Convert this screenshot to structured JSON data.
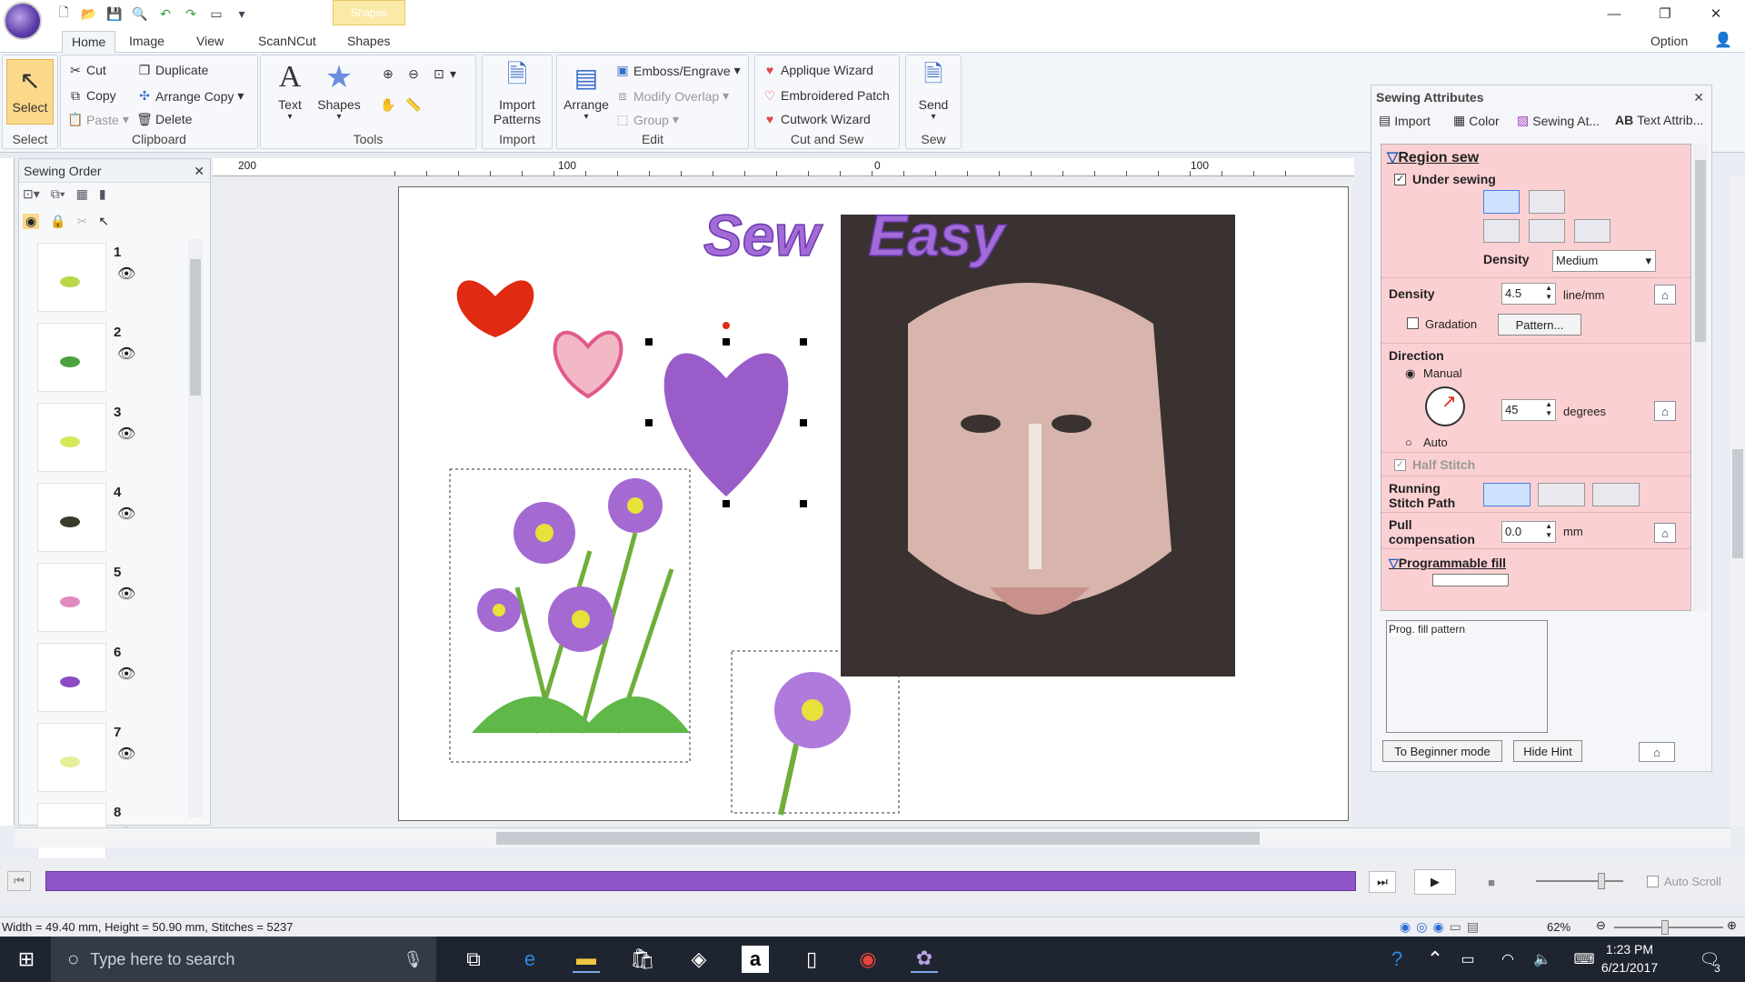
{
  "titlebar": {
    "context_tab": "Shapes",
    "option_label": "Option",
    "minimize": "—",
    "restore": "❐",
    "close": "✕"
  },
  "tabs": [
    "Home",
    "Image",
    "View",
    "ScanNCut",
    "Shapes"
  ],
  "ribbon": {
    "select": {
      "label": "Select",
      "group": "Select"
    },
    "clipboard": {
      "cut": "Cut",
      "copy": "Copy",
      "paste": "Paste",
      "duplicate": "Duplicate",
      "arrange_copy": "Arrange Copy",
      "delete": "Delete",
      "group": "Clipboard"
    },
    "tools": {
      "text": "Text",
      "shapes": "Shapes",
      "group": "Tools"
    },
    "import": {
      "label": "Import Patterns",
      "group": "Import"
    },
    "edit": {
      "arrange": "Arrange",
      "emboss": "Emboss/Engrave",
      "modify_overlap": "Modify Overlap",
      "group_btn": "Group",
      "group": "Edit"
    },
    "cutsew": {
      "applique": "Applique Wizard",
      "patch": "Embroidered Patch",
      "cutwork": "Cutwork Wizard",
      "group": "Cut and Sew"
    },
    "sew": {
      "send": "Send",
      "group": "Sew"
    }
  },
  "sewing_order": {
    "title": "Sewing Order",
    "items": [
      {
        "num": "1",
        "color": "#b8d84a"
      },
      {
        "num": "2",
        "color": "#4aa33c"
      },
      {
        "num": "3",
        "color": "#d6e85a"
      },
      {
        "num": "4",
        "color": "#3a3a2a"
      },
      {
        "num": "5",
        "color": "#e08ac0"
      },
      {
        "num": "6",
        "color": "#8a4bc4"
      },
      {
        "num": "7",
        "color": "#e8ef9a"
      },
      {
        "num": "8",
        "color": "#cccccc"
      }
    ]
  },
  "ruler": {
    "marks": [
      "200",
      "100",
      "0",
      "100"
    ]
  },
  "canvas": {
    "title_text": "Sew   Easy",
    "colors": {
      "heart_red": "#e02a12",
      "heart_pink": "#f2b8c6",
      "heart_purple": "#9a5cc8",
      "text_purple": "#a36bd6"
    }
  },
  "attributes": {
    "title": "Sewing Attributes",
    "subtabs": [
      "Import",
      "Color",
      "Sewing At...",
      "Text Attrib..."
    ],
    "region_sew": "Region sew",
    "under_sewing": "Under sewing",
    "density_label": "Density",
    "density_select": "Medium",
    "density2_label": "Density",
    "density_value": "4.5",
    "density_unit": "line/mm",
    "gradation": "Gradation",
    "pattern_btn": "Pattern...",
    "direction": "Direction",
    "manual": "Manual",
    "degrees_value": "45",
    "degrees": "degrees",
    "auto": "Auto",
    "half_stitch": "Half Stitch",
    "running_path": "Running Stitch Path",
    "pull": "Pull compensation",
    "pull_value": "0.0",
    "pull_unit": "mm",
    "prog_fill": "Programmable fill",
    "prog_pattern": "Prog. fill pattern",
    "beginner_btn": "To Beginner mode",
    "hide_hint": "Hide Hint"
  },
  "timeline": {
    "auto_scroll": "Auto Scroll"
  },
  "status": {
    "text": "Width = 49.40 mm, Height = 50.90 mm, Stitches = 5237",
    "zoom": "62%"
  },
  "taskbar": {
    "search_placeholder": "Type here to search",
    "time": "1:23 PM",
    "date": "6/21/2017",
    "notif_count": "3"
  }
}
